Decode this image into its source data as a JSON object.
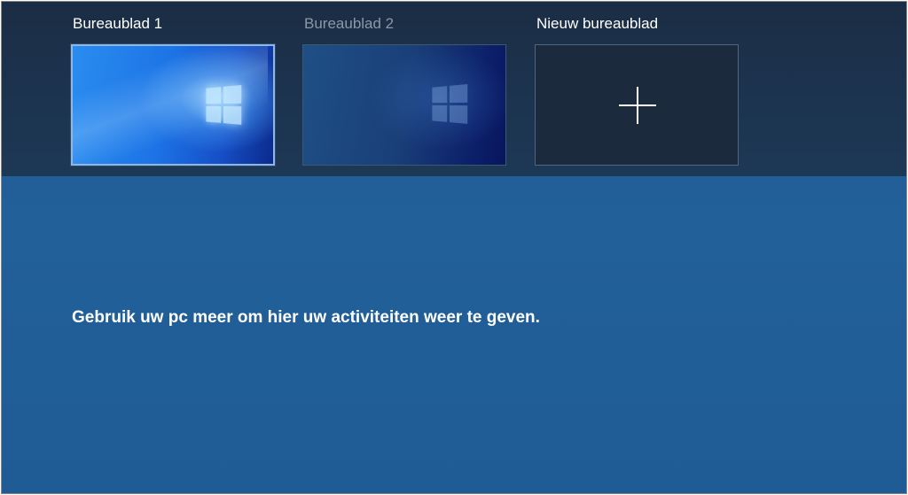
{
  "task_view": {
    "desktops": [
      {
        "label": "Bureaublad 1",
        "selected": true,
        "wallpaper": "windows-10-default-bright"
      },
      {
        "label": "Bureaublad 2",
        "selected": false,
        "wallpaper": "windows-10-default-dark"
      }
    ],
    "new_desktop": {
      "label": "Nieuw bureaublad",
      "icon": "plus-icon"
    },
    "timeline": {
      "empty_message": "Gebruik uw pc meer om hier uw activiteiten weer te geven."
    }
  },
  "colors": {
    "strip_background": "#1b2d44",
    "main_background": "#1f5a93",
    "selected_border": "#8db8e6",
    "inactive_label": "#8b98a8"
  }
}
